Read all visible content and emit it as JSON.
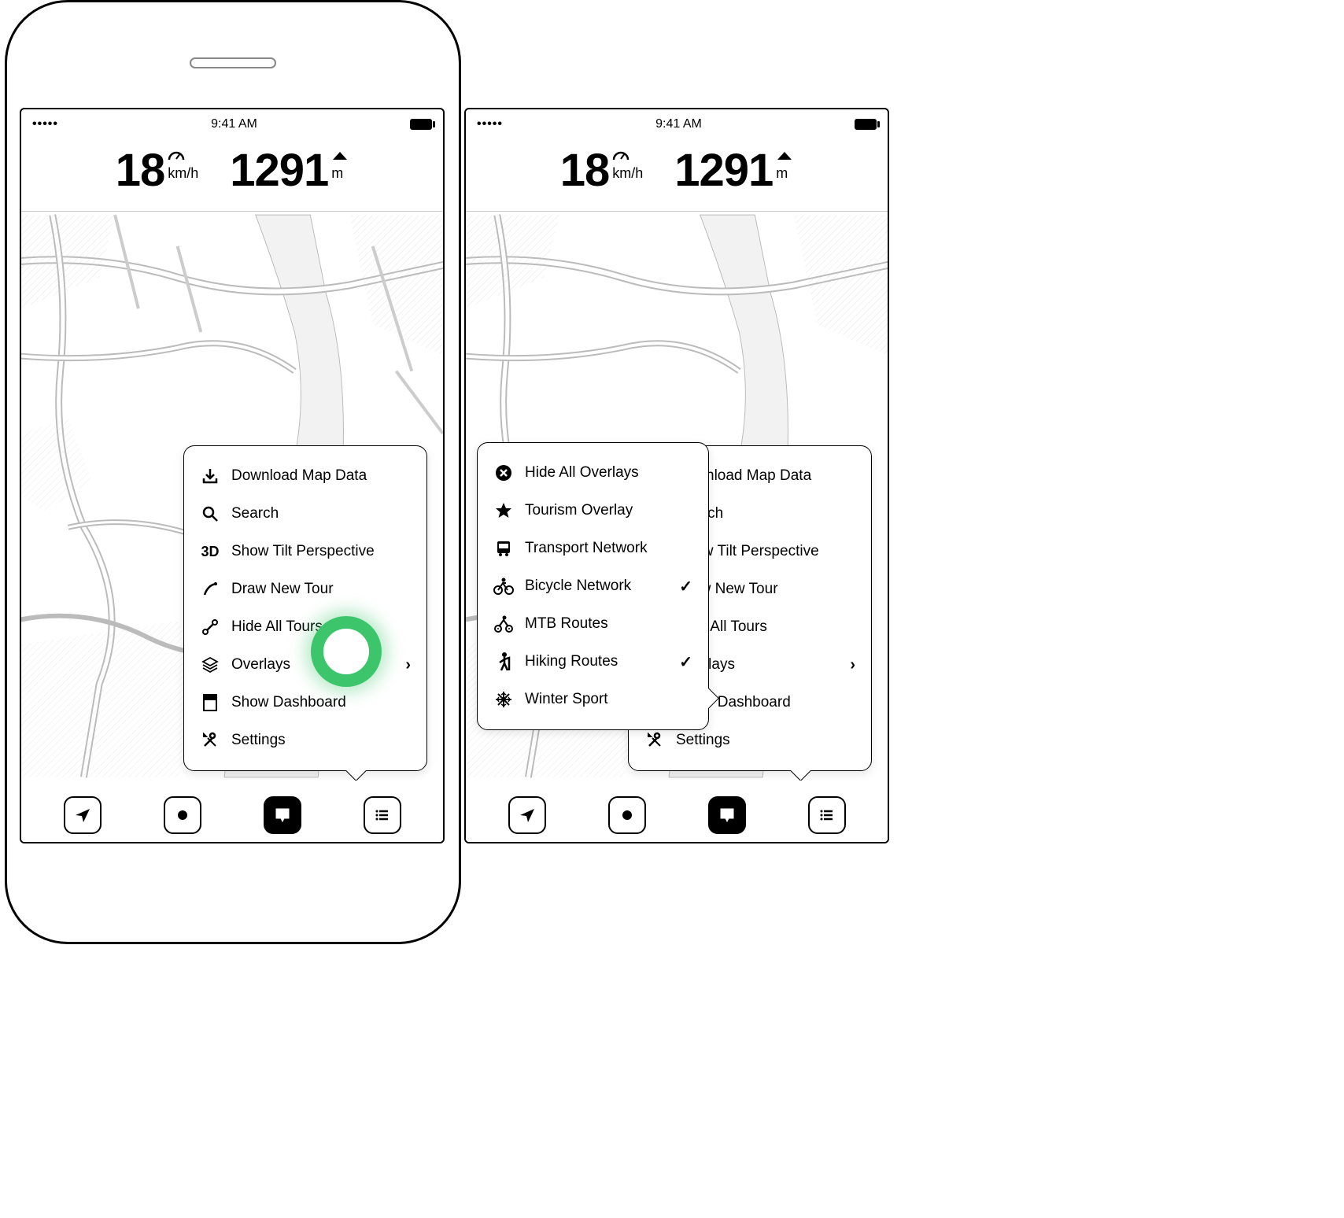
{
  "status": {
    "time": "9:41 AM"
  },
  "metrics": {
    "speed": {
      "value": "18",
      "unit": "km/h"
    },
    "altitude": {
      "value": "1291",
      "unit": "m"
    }
  },
  "main_menu": {
    "items": [
      {
        "label": "Download Map Data",
        "icon": "download-icon"
      },
      {
        "label": "Search",
        "icon": "search-icon"
      },
      {
        "label": "Show Tilt Perspective",
        "icon": "3d-icon"
      },
      {
        "label": "Draw New Tour",
        "icon": "draw-icon"
      },
      {
        "label": "Hide All Tours",
        "icon": "route-icon"
      },
      {
        "label": "Overlays",
        "icon": "layers-icon",
        "has_submenu": true
      },
      {
        "label": "Show Dashboard",
        "icon": "dashboard-icon"
      },
      {
        "label": "Settings",
        "icon": "tools-icon"
      }
    ]
  },
  "overlay_menu": {
    "items": [
      {
        "label": "Hide All Overlays",
        "icon": "close-circle-icon",
        "checked": false
      },
      {
        "label": "Tourism Overlay",
        "icon": "star-icon",
        "checked": false
      },
      {
        "label": "Transport Network",
        "icon": "bus-icon",
        "checked": false
      },
      {
        "label": "Bicycle Network",
        "icon": "bicycle-icon",
        "checked": true
      },
      {
        "label": "MTB Routes",
        "icon": "mtb-icon",
        "checked": false
      },
      {
        "label": "Hiking Routes",
        "icon": "hiker-icon",
        "checked": true
      },
      {
        "label": "Winter Sport",
        "icon": "snowflake-icon",
        "checked": false
      }
    ]
  }
}
